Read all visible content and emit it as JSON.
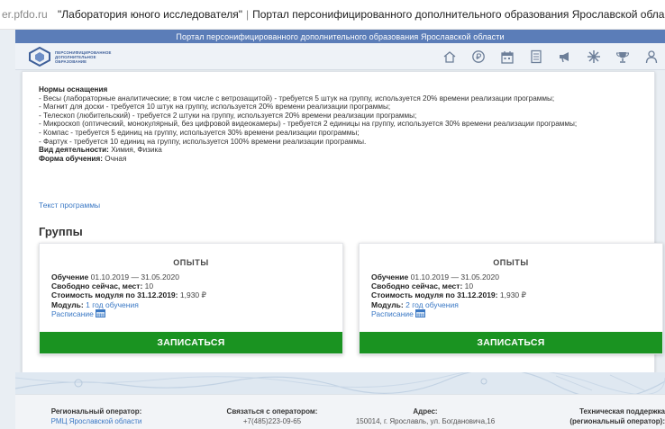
{
  "browser": {
    "domain": "er.pfdo.ru",
    "separator": "|",
    "title_quoted": "\"Лаборатория юного исследователя\"",
    "title_rest": "Портал персонифицированного дополнительного образования Ярославской области"
  },
  "header": {
    "portal_title": "Портал персонифицированного дополнительного образования Ярославской области",
    "logo_text": [
      "ПЕРСОНИФИЦИРОВАННОЕ",
      "ДОПОЛНИТЕЛЬНОЕ",
      "ОБРАЗОВАНИЕ"
    ],
    "nav_icons": [
      "home-icon",
      "ruble-coin-icon",
      "calendar-icon",
      "document-icon",
      "megaphone-icon",
      "atom-icon",
      "trophy-icon",
      "user-group-icon"
    ]
  },
  "program": {
    "equipment_heading": "Нормы оснащения",
    "equipment": [
      "- Весы (лабораторные аналитические; в том числе с ветрозащитой) - требуется 5 штук на группу, используется 20% времени реализации программы;",
      "- Магнит для доски - требуется 10 штук на группу, используется 20% времени реализации программы;",
      "- Телескоп (любительский) - требуется 2 штуки на группу, используется 20% времени реализации программы;",
      "- Микроскоп (оптический, монокулярный, без цифровой видеокамеры) - требуется 2 единицы на группу, используется 30% времени реализации программы;",
      "- Компас - требуется 5 единиц на группу, используется 30% времени реализации программы;",
      "- Фартук - требуется 10 единиц на группу, используется 100% времени реализации программы."
    ],
    "activity_label": "Вид деятельности:",
    "activity_value": "Химия, Физика",
    "form_label": "Форма обучения:",
    "form_value": "Очная",
    "program_text_link": "Текст программы"
  },
  "groups": {
    "title": "Группы",
    "items": [
      {
        "name": "ОПЫТЫ",
        "study_label": "Обучение",
        "study_value": "01.10.2019 — 31.05.2020",
        "free_label": "Свободно сейчас, мест:",
        "free_value": "10",
        "cost_label": "Стоимость модуля по 31.12.2019:",
        "cost_value": "1,930 ₽",
        "module_label": "Модуль:",
        "module_value": "1 год обучения",
        "schedule_label": "Расписание",
        "enroll_label": "ЗАПИСАТЬСЯ"
      },
      {
        "name": "ОПЫТЫ",
        "study_label": "Обучение",
        "study_value": "01.10.2019 — 31.05.2020",
        "free_label": "Свободно сейчас, мест:",
        "free_value": "10",
        "cost_label": "Стоимость модуля по 31.12.2019:",
        "cost_value": "1,930 ₽",
        "module_label": "Модуль:",
        "module_value": "2 год обучения",
        "schedule_label": "Расписание",
        "enroll_label": "ЗАПИСАТЬСЯ"
      }
    ]
  },
  "footer": {
    "operator_label": "Региональный оператор:",
    "operator_value": "РМЦ Ярославской области",
    "contact_label": "Связаться с оператором:",
    "contact_value": "+7(485)223-09-65",
    "address_label": "Адрес:",
    "address_value": "150014, г. Ярославль, ул. Богдановича,16",
    "support_label": "Техническая поддержка",
    "support_label2": "(региональный оператор):"
  },
  "colors": {
    "header_blue": "#5b7db8",
    "enroll_green": "#1a9321",
    "link_blue": "#3a78c4"
  }
}
